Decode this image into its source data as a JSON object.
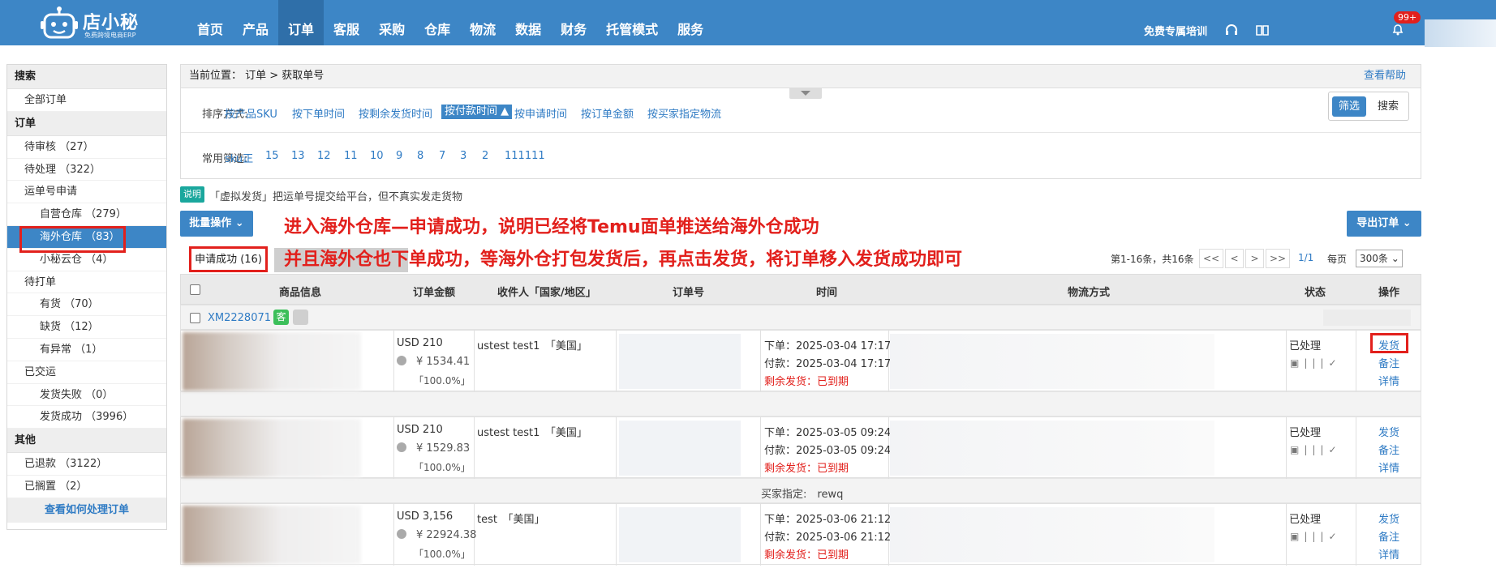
{
  "topbar": {
    "logo_text": "店小秘",
    "logo_sub": "免费跨境电商ERP",
    "nav": [
      "首页",
      "产品",
      "订单",
      "客服",
      "采购",
      "仓库",
      "物流",
      "数据",
      "财务",
      "托管模式",
      "服务"
    ],
    "active_nav": "订单",
    "training": "免费专属培训",
    "badge": "99+"
  },
  "sidebar": {
    "search_head": "搜索",
    "all_orders": "全部订单",
    "order_head": "订单",
    "items": [
      {
        "label": "待审核 （27）",
        "level": 1
      },
      {
        "label": "待处理 （322）",
        "level": 1
      },
      {
        "label": "运单号申请",
        "level": 1
      },
      {
        "label": "自营仓库 （279）",
        "level": 2
      },
      {
        "label": "海外仓库 （83）",
        "level": 2,
        "active": true
      },
      {
        "label": "小秘云仓 （4）",
        "level": 2
      },
      {
        "label": "待打单",
        "level": 1
      },
      {
        "label": "有货 （70）",
        "level": 2
      },
      {
        "label": "缺货 （12）",
        "level": 2
      },
      {
        "label": "有异常 （1）",
        "level": 2
      },
      {
        "label": "已交运",
        "level": 1
      },
      {
        "label": "发货失败 （0）",
        "level": 2
      },
      {
        "label": "发货成功 （3996）",
        "level": 2
      }
    ],
    "other_head": "其他",
    "other_items": [
      "已退款 （3122）",
      "已搁置 （2）"
    ],
    "footer": "查看如何处理订单"
  },
  "breadcrumb": {
    "text": "当前位置： 订单 > 获取单号",
    "help": "查看帮助"
  },
  "sort": {
    "label": "排序方式:",
    "options": [
      "按产品SKU",
      "按下单时间",
      "按剩余发货时间",
      "按付款时间 ▲",
      "按申请时间",
      "按订单金额",
      "按买家指定物流"
    ],
    "selected_index": 3
  },
  "filter_btns": {
    "filter": "筛选",
    "search": "搜索"
  },
  "quick": {
    "label": "常用筛选:",
    "options": [
      "sku正",
      "15",
      "13",
      "12",
      "11",
      "10",
      "9",
      "8",
      "7",
      "3",
      "2",
      "111111"
    ]
  },
  "note": {
    "tag": "说明",
    "text": "「虚拟发货」把运单号提交给平台，但不真实发走货物"
  },
  "actions": {
    "bulk": "批量操作 ⌄",
    "export": "导出订单 ⌄"
  },
  "annotations": {
    "line1": "进入海外仓库—申请成功，说明已经将Temu面单推送给海外仓成功",
    "line2": "并且海外仓也下单成功，等海外仓打包发货后，再点击发货，将订单移入发货成功即可"
  },
  "tab_success": "申请成功 (16)",
  "pager": {
    "info": "第1-16条，共16条",
    "buttons": [
      "<<",
      "<",
      ">",
      ">>"
    ],
    "current": "1/1",
    "per_label": "每页",
    "per_value": "300条 ⌄"
  },
  "table": {
    "headers": [
      "商品信息",
      "订单金额",
      "收件人「国家/地区」",
      "订单号",
      "时间",
      "物流方式",
      "状态",
      "操作"
    ],
    "group_order": "XM2228071",
    "group_tag": "客",
    "orders": [
      {
        "usd": "USD 210",
        "cny": "¥ 1534.41",
        "pct": "「100.0%」",
        "recv": "ustest test1　「美国」",
        "order_time": "下单：2025-03-04 17:17",
        "pay_time": "付款：2025-03-04 17:17",
        "remain": "剩余发货：已到期",
        "status": "已处理",
        "ops": [
          "发货",
          "备注",
          "详情"
        ]
      },
      {
        "usd": "USD 210",
        "cny": "¥ 1529.83",
        "pct": "「100.0%」",
        "recv": "ustest test1　「美国」",
        "order_time": "下单：2025-03-05 09:24",
        "pay_time": "付款：2025-03-05 09:24",
        "remain": "剩余发货：已到期",
        "status": "已处理",
        "ops": [
          "发货",
          "备注",
          "详情"
        ]
      },
      {
        "usd": "USD 3,156",
        "cny": "¥ 22924.38",
        "pct": "「100.0%」",
        "recv": "test　「美国」",
        "order_time": "下单：2025-03-06 21:12",
        "pay_time": "付款：2025-03-06 21:12",
        "remain": "剩余发货：已到期",
        "status": "已处理",
        "ops": [
          "发货",
          "备注",
          "详情"
        ]
      }
    ],
    "buyer_note": "买家指定:　rewq"
  }
}
